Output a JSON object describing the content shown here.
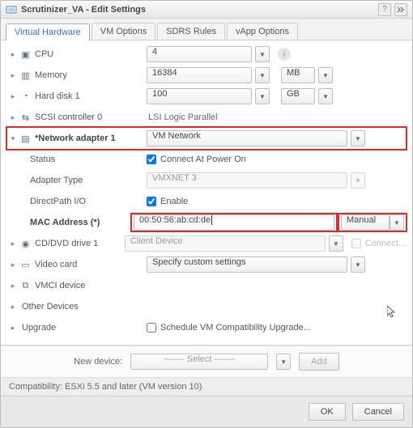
{
  "window": {
    "title": "Scrutinizer_VA - Edit Settings"
  },
  "tabs": [
    "Virtual Hardware",
    "VM Options",
    "SDRS Rules",
    "vApp Options"
  ],
  "hardware": {
    "cpu": {
      "label": "CPU",
      "value": "4"
    },
    "memory": {
      "label": "Memory",
      "value": "16384",
      "unit": "MB"
    },
    "disk1": {
      "label": "Hard disk 1",
      "value": "100",
      "unit": "GB"
    },
    "scsi0": {
      "label": "SCSI controller 0",
      "value": "LSI Logic Parallel"
    },
    "nic1": {
      "label": "*Network adapter 1",
      "network": "VM Network",
      "status_label": "Status",
      "connect_label": "Connect At Power On",
      "adapter_type_label": "Adapter Type",
      "adapter_type": "VMXNET 3",
      "directpath_label": "DirectPath I/O",
      "enable_label": "Enable",
      "mac_label": "MAC Address (*)",
      "mac": "00:50:56:ab:cd:de",
      "mac_mode": "Manual"
    },
    "cdrom": {
      "label": "CD/DVD drive 1",
      "value": "Client Device",
      "connect_label": "Connect..."
    },
    "video": {
      "label": "Video card",
      "value": "Specify custom settings"
    },
    "vmci": {
      "label": "VMCI device"
    },
    "other": {
      "label": "Other Devices"
    },
    "upgrade": {
      "label": "Upgrade",
      "schedule_label": "Schedule VM Compatibility Upgrade..."
    }
  },
  "new_device": {
    "label": "New device:",
    "select_placeholder": "------- Select -------",
    "add_button": "Add"
  },
  "compatibility": {
    "text": "Compatibility: ESXi 5.5 and later (VM version 10)"
  },
  "footer": {
    "ok": "OK",
    "cancel": "Cancel"
  }
}
